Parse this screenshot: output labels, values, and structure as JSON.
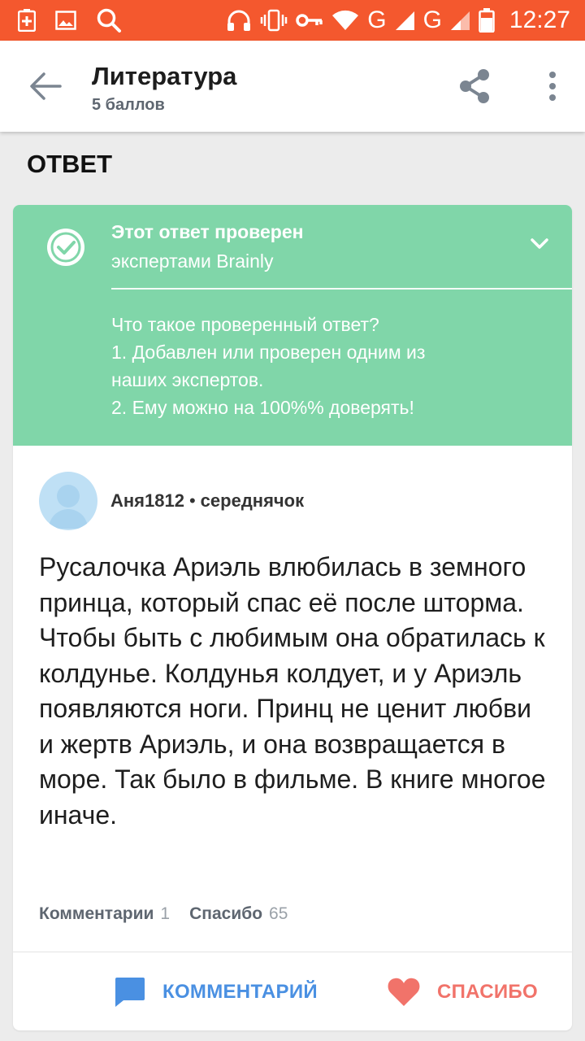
{
  "status_bar": {
    "network_label_1": "G",
    "network_label_2": "G",
    "time": "12:27"
  },
  "app_bar": {
    "title": "Литература",
    "subtitle": "5 баллов"
  },
  "section": {
    "title": "ОТВЕТ"
  },
  "verified": {
    "title": "Этот ответ проверен",
    "subtitle": "экспертами Brainly",
    "info_lines": [
      "Что такое проверенный ответ?",
      "1. Добавлен или проверен одним из",
      "наших экспертов.",
      "2. Ему можно на 100%% доверять!"
    ],
    "colors": {
      "background": "#80d6a9"
    }
  },
  "answer": {
    "author_name": "Аня1812",
    "author_separator": "•",
    "author_rank": "середнячок",
    "text": "Русалочка Ариэль влюбилась в земного принца, который спас её после шторма. Чтобы быть с любимым она обратилась к колдунье.  Колдунья колдует, и у Ариэль появляются ноги. Принц не ценит любви и жертв Ариэль, и она возвращается в море. Так было в фильме. В книге многое иначе.",
    "comments_label": "Комментарии",
    "comments_count": "1",
    "thanks_label": "Спасибо",
    "thanks_count": "65"
  },
  "actions": {
    "comment_label": "КОММЕНТАРИЙ",
    "thanks_label": "СПАСИБО",
    "colors": {
      "comment": "#4a90e2",
      "thanks": "#f1736a"
    }
  },
  "icons": [
    "battery-plus-icon",
    "image-icon",
    "search-icon",
    "headphones-icon",
    "vibrate-icon",
    "key-icon",
    "wifi-icon",
    "signal-icon",
    "battery-icon",
    "back-arrow-icon",
    "share-icon",
    "more-vert-icon",
    "check-circle-icon",
    "chevron-down-icon",
    "avatar-placeholder-icon",
    "comment-icon",
    "heart-icon"
  ]
}
